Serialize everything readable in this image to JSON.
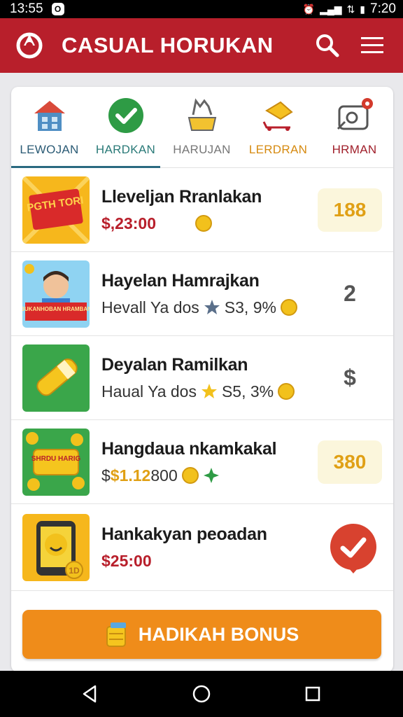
{
  "status_bar": {
    "time_left": "13:55",
    "notification_badge": "O",
    "time_right": "7:20"
  },
  "app_bar": {
    "title": "CASUAL HORUKAN",
    "logo_icon": "spiral-logo-icon",
    "search_icon": "search-icon",
    "menu_icon": "hamburger-menu-icon"
  },
  "tabs": [
    {
      "label": "LEWOJAN",
      "icon": "house-icon",
      "color": "#2b5b75",
      "active": false
    },
    {
      "label": "HARDKAN",
      "icon": "checkmark-icon",
      "color": "#2a7a78",
      "active": true
    },
    {
      "label": "HARUJAN",
      "icon": "basket-icon",
      "color": "#777777",
      "active": false
    },
    {
      "label": "LERDRAN",
      "icon": "cart-icon",
      "color": "#d68a10",
      "active": false
    },
    {
      "label": "HRMAN",
      "icon": "camera-icon",
      "color": "#a0202b",
      "active": false
    }
  ],
  "items": [
    {
      "title": "Lleveljan Rranlakan",
      "price": "$,23:00",
      "thumb_text": "PGTH TORI",
      "badge": "188"
    },
    {
      "title": "Hayelan Hamrajkan",
      "sub_text": "Hevall Ya dos",
      "sub_value": "S3, 9%",
      "thumb_text": "BUKANHOBAN HRAMBAN",
      "badge": "2"
    },
    {
      "title": "Deyalan Ramilkan",
      "sub_text": "Haual Ya dos",
      "sub_value": "S5, 3%",
      "badge": "$"
    },
    {
      "title": "Hangdaua nkamkakal",
      "price_prefix": "$",
      "price": "$1.12",
      "price_suffix": "800",
      "thumb_text": "SHRDU HARIG",
      "badge": "380"
    },
    {
      "title": "Hankakyan peoadan",
      "price": "$25:00",
      "thumb_text": "1D"
    }
  ],
  "bonus_button": {
    "label": "HADIKAH BONUS",
    "icon": "coin-jar-icon"
  },
  "nav_bar": {
    "back_icon": "back-triangle-icon",
    "home_icon": "home-circle-icon",
    "recents_icon": "recents-square-icon"
  },
  "colors": {
    "brand_red": "#b81f2b",
    "accent_orange": "#ef8c1a",
    "badge_gold": "#e0a015"
  }
}
